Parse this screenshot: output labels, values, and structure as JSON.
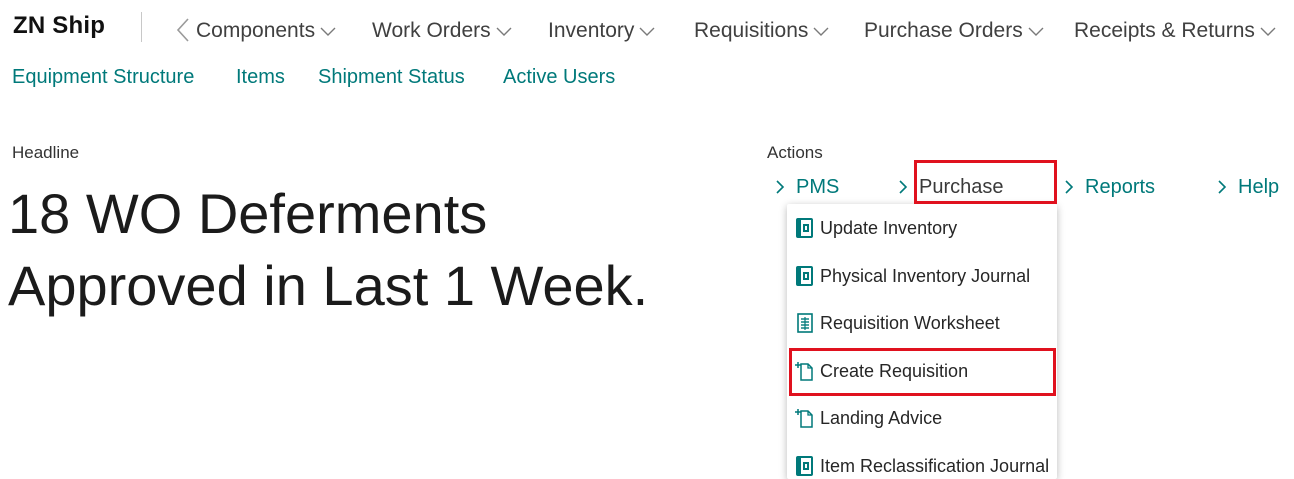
{
  "app": {
    "title": "ZN Ship"
  },
  "nav": {
    "items": [
      {
        "label": "Components"
      },
      {
        "label": "Work Orders"
      },
      {
        "label": "Inventory"
      },
      {
        "label": "Requisitions"
      },
      {
        "label": "Purchase Orders"
      },
      {
        "label": "Receipts & Returns"
      }
    ]
  },
  "subnav": {
    "items": [
      {
        "label": "Equipment Structure"
      },
      {
        "label": "Items"
      },
      {
        "label": "Shipment Status"
      },
      {
        "label": "Active Users"
      }
    ]
  },
  "headline": {
    "caption": "Headline",
    "line1": "18 WO Deferments",
    "line2": "Approved in Last 1 Week."
  },
  "actions": {
    "caption": "Actions",
    "items": [
      {
        "label": "PMS"
      },
      {
        "label": "Purchase"
      },
      {
        "label": "Reports"
      },
      {
        "label": "Help"
      }
    ]
  },
  "purchase_menu": {
    "items": [
      {
        "label": "Update Inventory",
        "icon": "journal-icon"
      },
      {
        "label": "Physical Inventory Journal",
        "icon": "journal-icon"
      },
      {
        "label": "Requisition Worksheet",
        "icon": "worksheet-icon"
      },
      {
        "label": "Create Requisition",
        "icon": "new-document-icon"
      },
      {
        "label": "Landing Advice",
        "icon": "new-document-icon"
      },
      {
        "label": "Item Reclassification Journal",
        "icon": "journal-icon"
      }
    ]
  },
  "colors": {
    "accent": "#00797a",
    "highlight": "#e0111e",
    "text": "#212121"
  }
}
